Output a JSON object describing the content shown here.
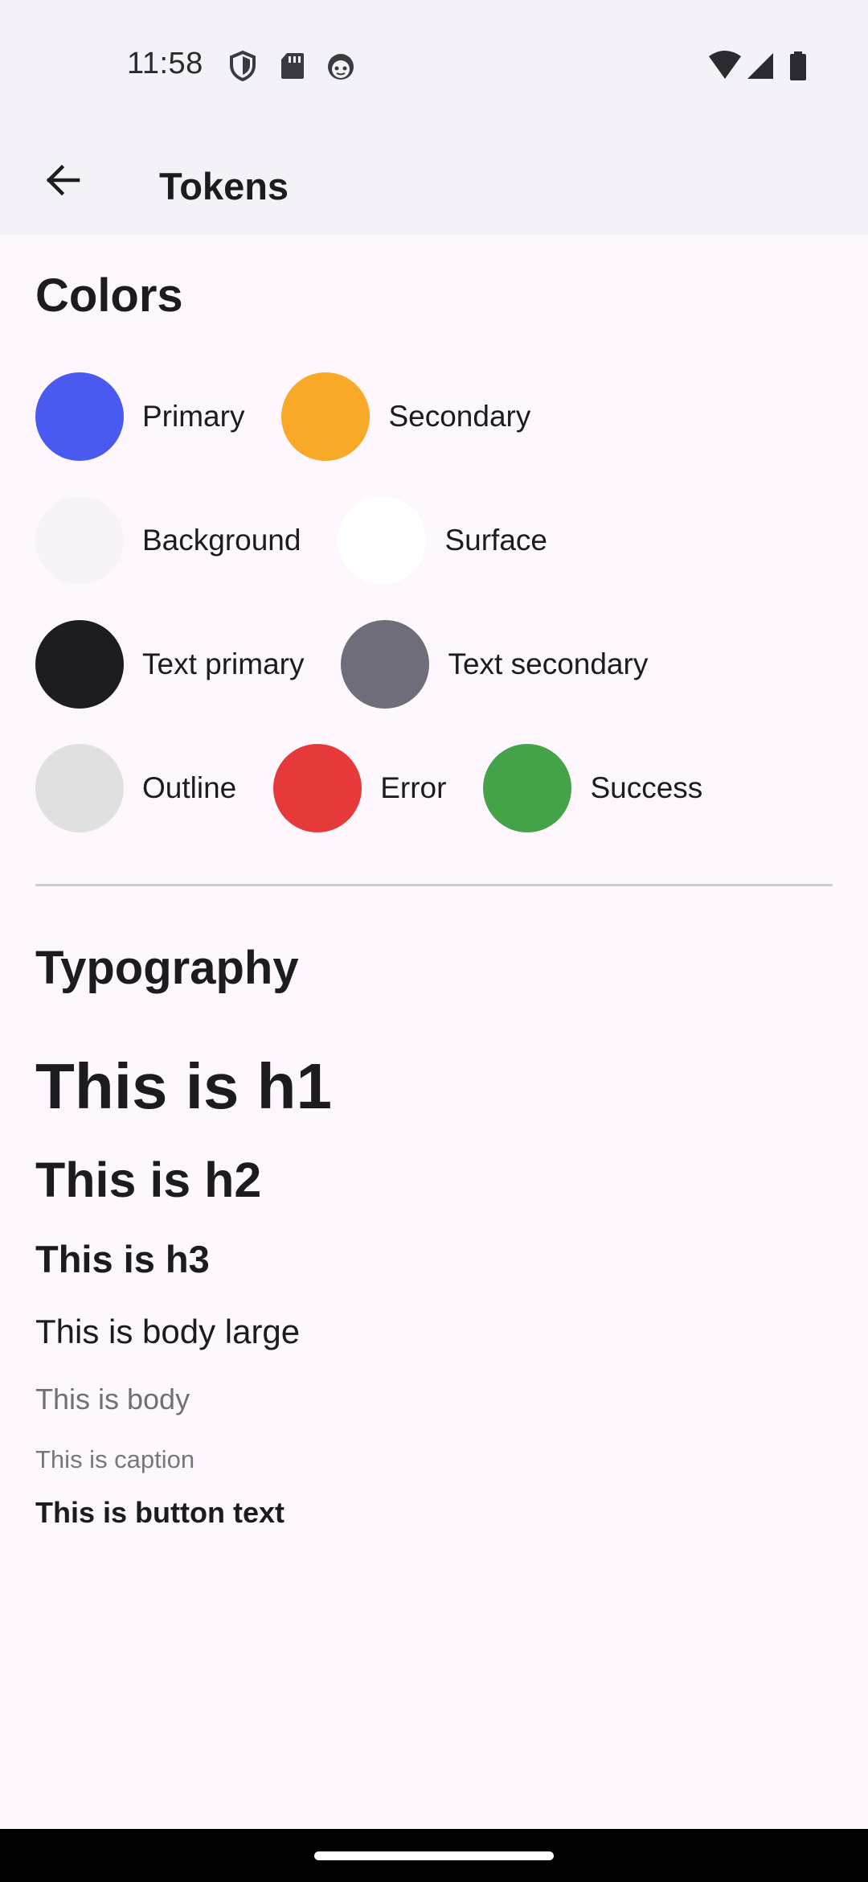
{
  "status_bar": {
    "time": "11:58",
    "left_icons": [
      "shield-icon",
      "sd-card-icon",
      "android-face-icon"
    ],
    "right_icons": [
      "wifi-icon",
      "signal-icon",
      "battery-icon"
    ]
  },
  "app_bar": {
    "title": "Tokens",
    "back_icon": "arrow-back-icon"
  },
  "colors_section": {
    "title": "Colors",
    "swatches": [
      {
        "label": "Primary",
        "color": "#4a5af0"
      },
      {
        "label": "Secondary",
        "color": "#f8a928"
      },
      {
        "label": "Background",
        "color": "#f6f4f6"
      },
      {
        "label": "Surface",
        "color": "#ffffff"
      },
      {
        "label": "Text primary",
        "color": "#1d1c21"
      },
      {
        "label": "Text secondary",
        "color": "#6e6d79"
      },
      {
        "label": "Outline",
        "color": "#e0e0e0"
      },
      {
        "label": "Error",
        "color": "#e63a3a"
      },
      {
        "label": "Success",
        "color": "#44a348"
      }
    ]
  },
  "typography_section": {
    "title": "Typography",
    "h1": "This is h1",
    "h2": "This is h2",
    "h3": "This is h3",
    "body_large": "This is body large",
    "body": "This is body",
    "caption": "This is caption",
    "button_text": "This is button text"
  },
  "nav_bar": {
    "home_indicator": "home-indicator"
  }
}
